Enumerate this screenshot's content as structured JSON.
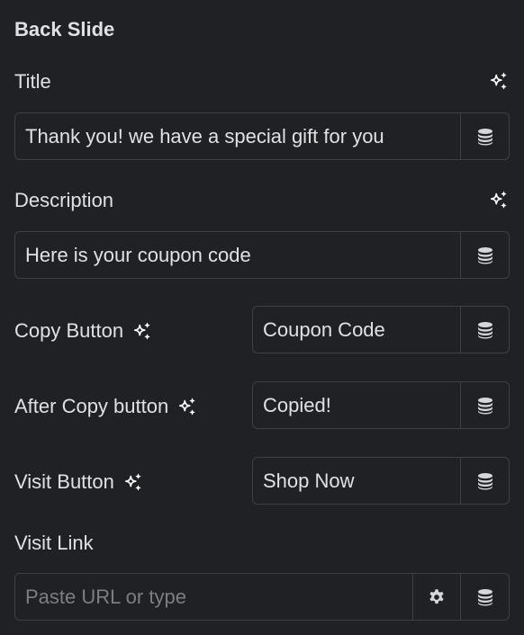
{
  "section": {
    "title": "Back Slide"
  },
  "fields": {
    "title": {
      "label": "Title",
      "value": "Thank you! we have a special gift for you",
      "ai_icon": "sparkle-icon",
      "dynamic_icon": "database-icon"
    },
    "description": {
      "label": "Description",
      "value": "Here is your coupon code",
      "ai_icon": "sparkle-icon",
      "dynamic_icon": "database-icon"
    },
    "copy_button": {
      "label": "Copy Button",
      "value": "Coupon Code",
      "ai_icon": "sparkle-icon",
      "dynamic_icon": "database-icon"
    },
    "after_copy_button": {
      "label": "After Copy button",
      "value": "Copied!",
      "ai_icon": "sparkle-icon",
      "dynamic_icon": "database-icon"
    },
    "visit_button": {
      "label": "Visit Button",
      "value": "Shop Now",
      "ai_icon": "sparkle-icon",
      "dynamic_icon": "database-icon"
    },
    "visit_link": {
      "label": "Visit Link",
      "value": "",
      "placeholder": "Paste URL or type",
      "settings_icon": "gear-icon",
      "dynamic_icon": "database-icon"
    }
  }
}
